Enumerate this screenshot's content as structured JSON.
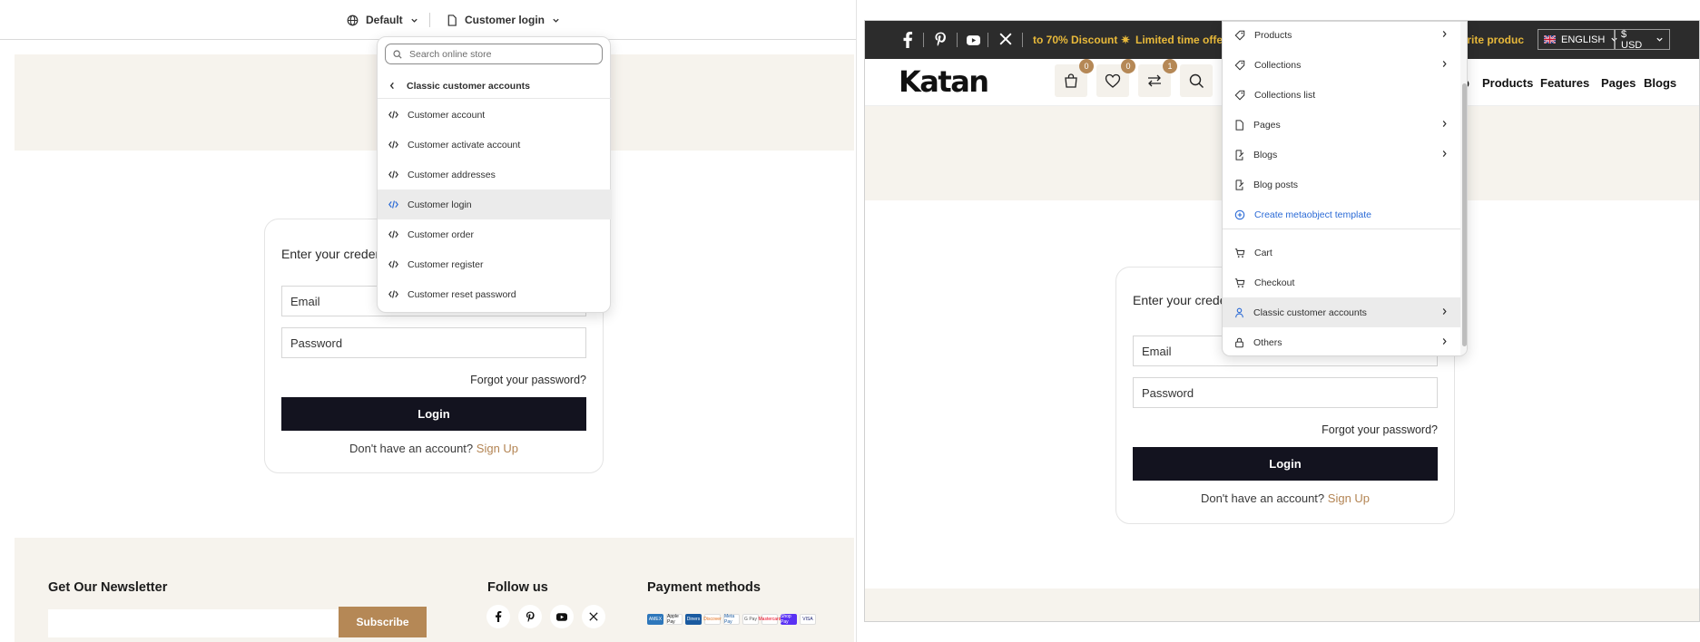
{
  "editor": {
    "theme_label": "Default",
    "template_label": "Customer login"
  },
  "template_dropdown": {
    "search_placeholder": "Search online store",
    "back_label": "Classic customer accounts",
    "items": [
      {
        "label": "Customer account"
      },
      {
        "label": "Customer activate account"
      },
      {
        "label": "Customer addresses"
      },
      {
        "label": "Customer login",
        "active": true
      },
      {
        "label": "Customer order"
      },
      {
        "label": "Customer register"
      },
      {
        "label": "Customer reset password"
      }
    ]
  },
  "login": {
    "card_title": "Enter your credentials",
    "card_title_visible_left": "Enter your creden",
    "card_title_visible_right": "Enter your crede",
    "email_placeholder": "Email",
    "password_placeholder": "Password",
    "forgot": "Forgot your password?",
    "login_button": "Login",
    "no_account": "Don't have an account?",
    "signup": "Sign Up"
  },
  "footer": {
    "newsletter_heading": "Get Our Newsletter",
    "subscribe": "Subscribe",
    "follow_heading": "Follow us",
    "payment_heading": "Payment methods",
    "payment_methods": [
      "AMEX",
      "Apple Pay",
      "Diners",
      "Discover",
      "Meta Pay",
      "G Pay",
      "Mastercard",
      "Shop Pay",
      "VISA"
    ]
  },
  "preview": {
    "marquee_left": "to 70% Discount",
    "marquee_mid": "Limited time offer",
    "marquee_right": "orite produc",
    "language": "ENGLISH",
    "currency": "$ USD",
    "logo": "Katan",
    "cart_count": "0",
    "wishlist_count": "0",
    "compare_count": "1",
    "nav": [
      "p",
      "Products",
      "Features",
      "Pages",
      "Blogs"
    ]
  },
  "page_menu": {
    "items": [
      {
        "label": "Products",
        "icon": "tag-icon",
        "chevron": true
      },
      {
        "label": "Collections",
        "icon": "tags-icon",
        "chevron": true
      },
      {
        "label": "Collections list",
        "icon": "tags-icon",
        "chevron": false
      },
      {
        "label": "Pages",
        "icon": "page-icon",
        "chevron": true
      },
      {
        "label": "Blogs",
        "icon": "blog-icon",
        "chevron": true
      },
      {
        "label": "Blog posts",
        "icon": "blog-icon",
        "chevron": false
      },
      {
        "label": "Create metaobject template",
        "icon": "plus-circle-icon",
        "chevron": false,
        "link": true
      },
      {
        "label": "Cart",
        "icon": "cart-icon",
        "chevron": false
      },
      {
        "label": "Checkout",
        "icon": "cart-icon",
        "chevron": false
      },
      {
        "label": "Classic customer accounts",
        "icon": "person-icon",
        "chevron": true,
        "active": true
      },
      {
        "label": "Others",
        "icon": "lock-icon",
        "chevron": true
      }
    ]
  },
  "colors": {
    "accent": "#b58856",
    "dark": "#13131f",
    "beige": "#f6f3ed",
    "marquee": "#e8b93a",
    "link": "#2a6ad6"
  }
}
